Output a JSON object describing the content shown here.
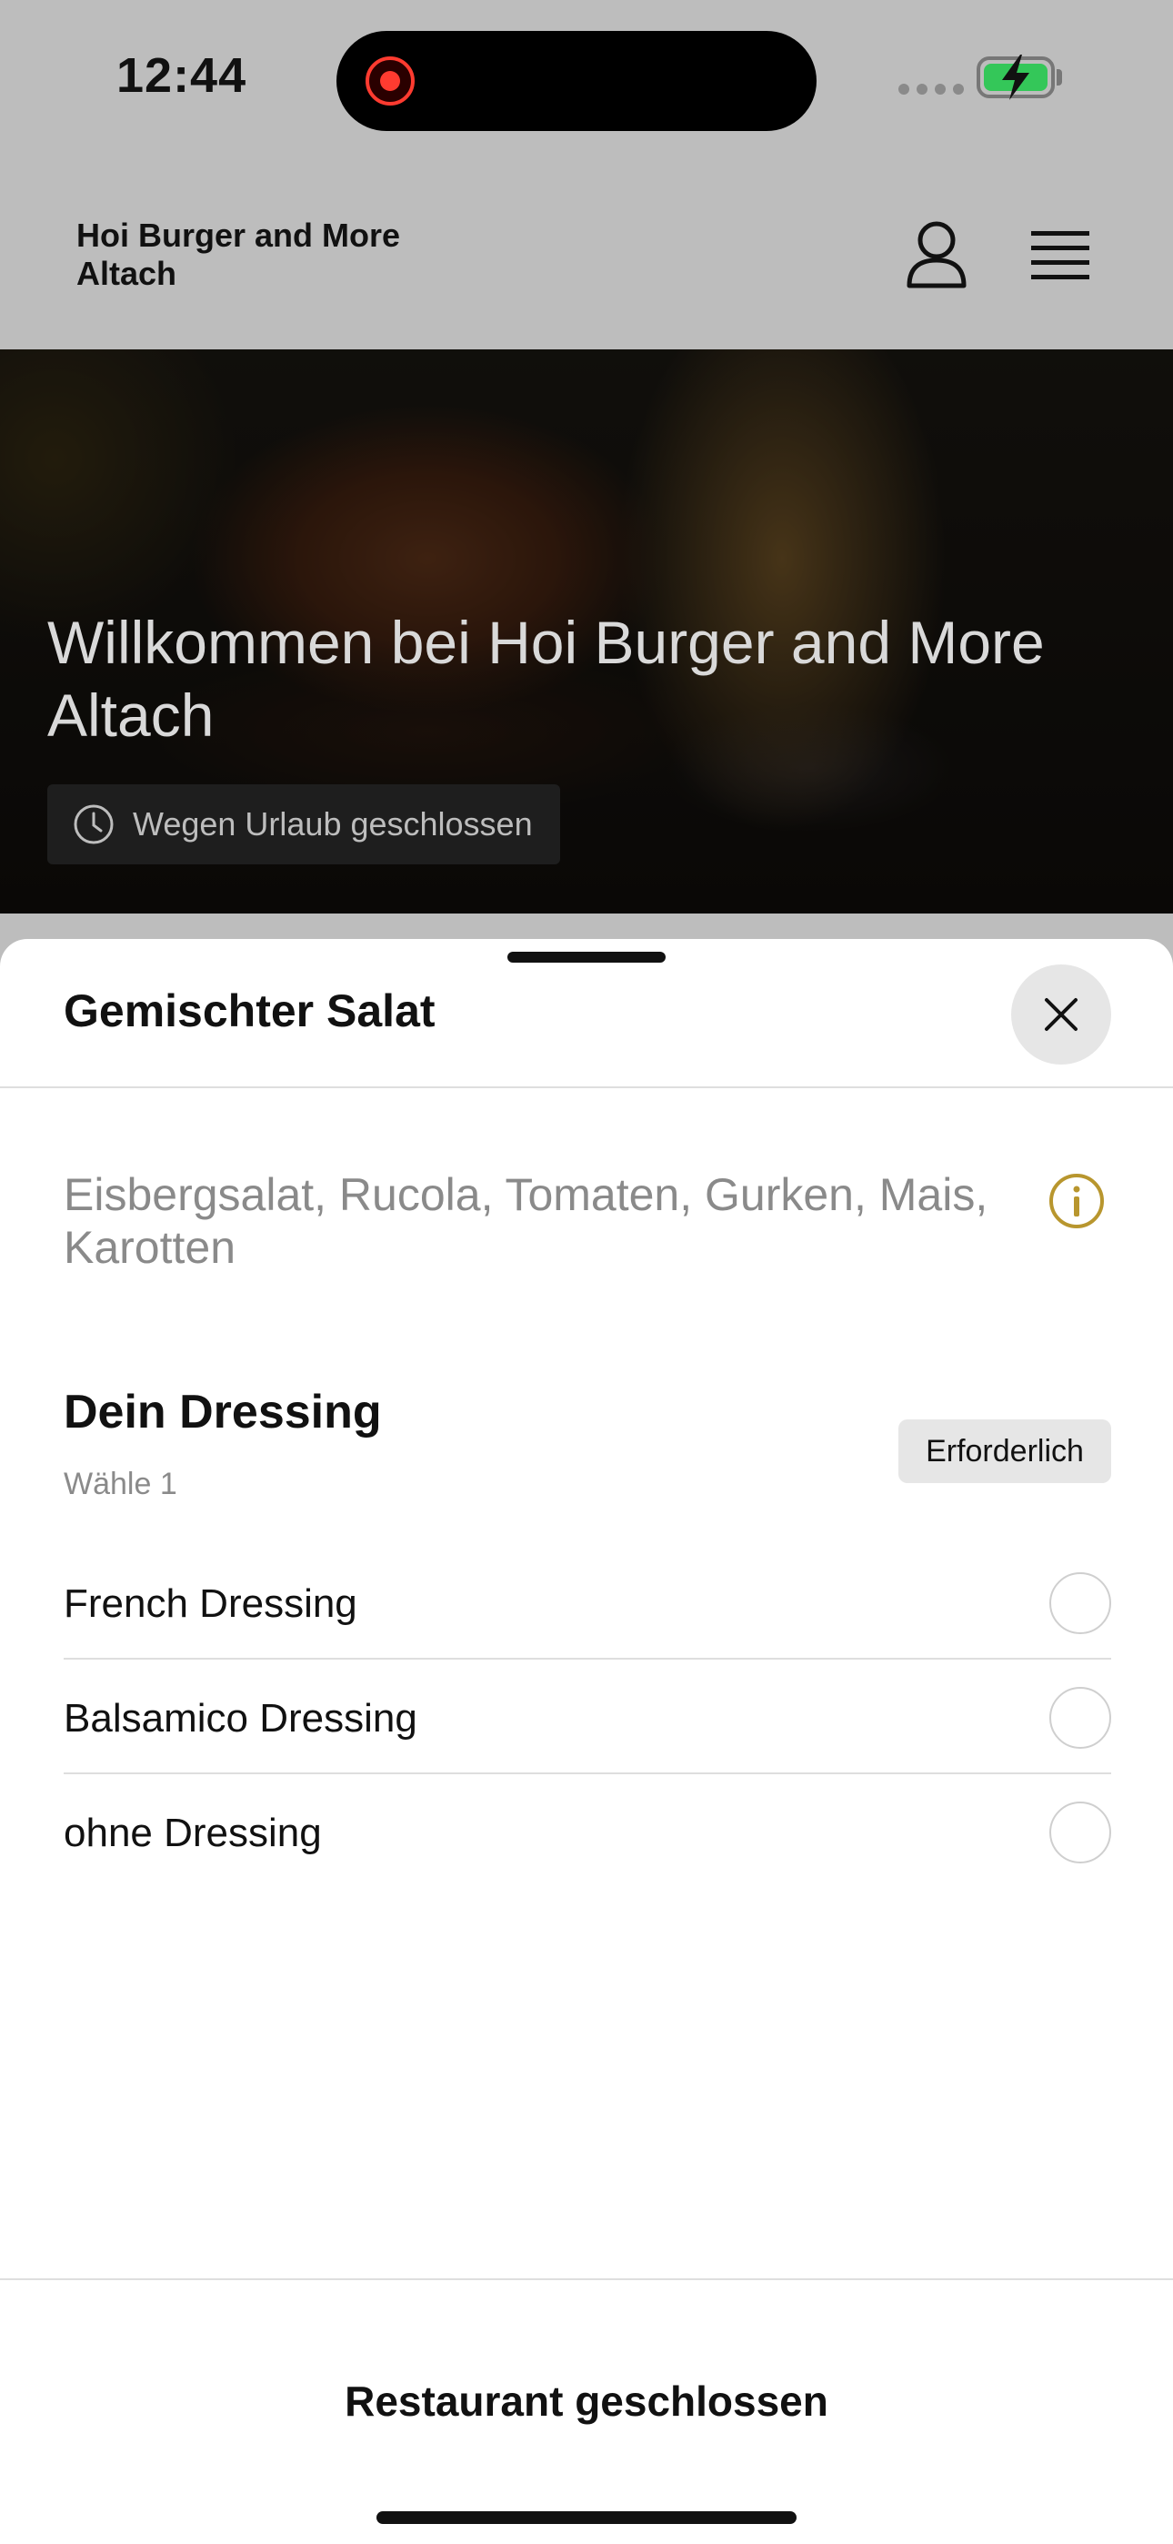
{
  "status_bar": {
    "time": "12:44"
  },
  "header": {
    "restaurant_name": "Hoi Burger and More Altach",
    "user_icon": "user-icon",
    "menu_icon": "menu-icon"
  },
  "hero": {
    "title": "Willkommen bei Hoi Burger and More Altach",
    "closed_notice": "Wegen Urlaub geschlossen"
  },
  "sheet": {
    "title": "Gemischter Salat",
    "description": "Eisbergsalat, Rucola, Tomaten, Gurken, Mais, Karotten",
    "option_group": {
      "title": "Dein Dressing",
      "subtitle": "Wähle 1",
      "required_label": "Erforderlich",
      "options": [
        {
          "label": "French Dressing"
        },
        {
          "label": "Balsamico Dressing"
        },
        {
          "label": "ohne Dressing"
        }
      ]
    },
    "footer_label": "Restaurant geschlossen"
  },
  "colors": {
    "accent_info": "#b8962e",
    "sheet_bg": "#ffffff",
    "dim_overlay": "#bdbdbd"
  }
}
